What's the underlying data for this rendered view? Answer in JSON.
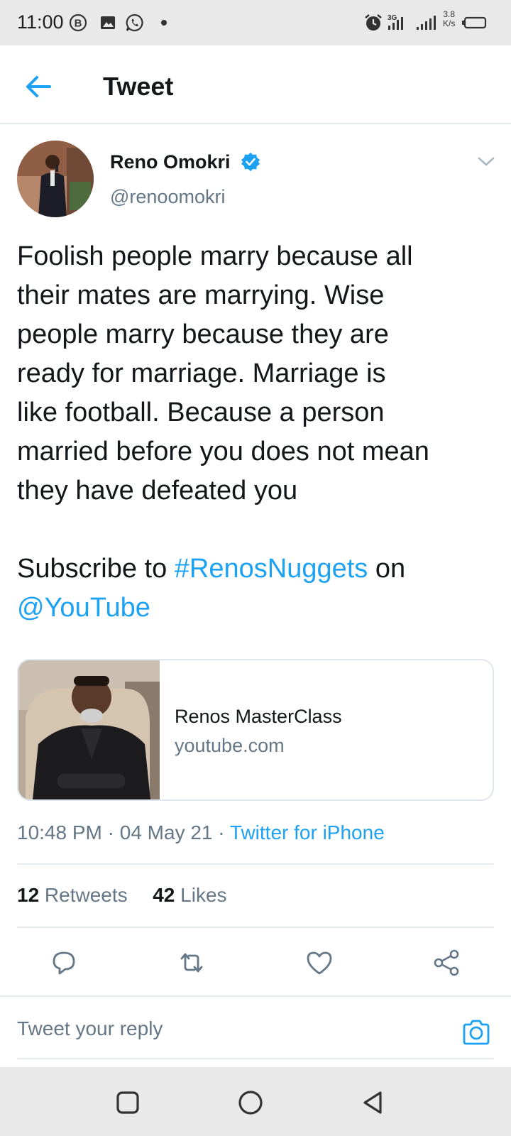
{
  "status_bar": {
    "time": "11:00",
    "net_speed_value": "3.8",
    "net_speed_unit": "K/s",
    "icons": [
      "b-circle-icon",
      "image-icon",
      "whatsapp-icon",
      "dot-icon",
      "alarm-icon",
      "signal-3g-icon",
      "signal-icon",
      "battery-icon"
    ]
  },
  "header": {
    "title": "Tweet",
    "back_icon": "arrow-left-icon"
  },
  "author": {
    "name": "Reno Omokri",
    "handle": "@renoomokri",
    "verified": true
  },
  "tweet": {
    "text_lines": [
      "Foolish people marry because all",
      "their mates are marrying. Wise",
      "people marry because they are",
      "ready for marriage. Marriage is",
      "like football. Because a person",
      "married before you does not mean",
      "they have defeated you"
    ],
    "subscribe_prefix": "Subscribe to ",
    "hashtag": "#RenosNuggets",
    "on_text": " on",
    "mention": "@YouTube"
  },
  "card": {
    "title": "Renos MasterClass",
    "domain": "youtube.com"
  },
  "meta": {
    "time": "10:48 PM",
    "sep1": " · ",
    "date": "04 May 21",
    "sep2": " · ",
    "source": "Twitter for iPhone"
  },
  "stats": {
    "retweets_count": "12",
    "retweets_label": " Retweets",
    "likes_count": "42",
    "likes_label": " Likes"
  },
  "actions": [
    "reply-icon",
    "retweet-icon",
    "like-icon",
    "share-icon"
  ],
  "reply": {
    "placeholder": "Tweet your reply"
  },
  "colors": {
    "accent": "#1da1f2",
    "text": "#14171a",
    "secondary": "#657786",
    "divider": "#e6ecf0",
    "system_bar": "#e9e9e9"
  }
}
